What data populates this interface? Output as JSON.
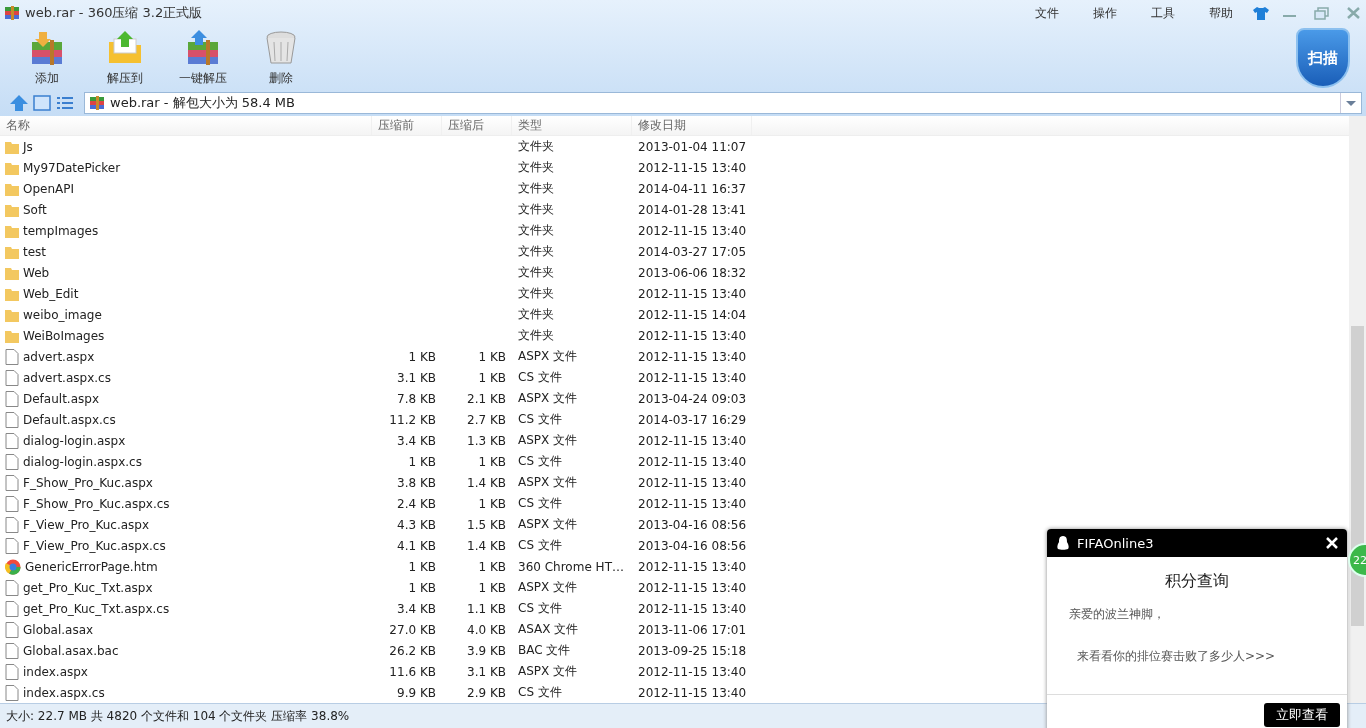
{
  "window": {
    "title": "web.rar - 360压缩 3.2正式版"
  },
  "menu": [
    "文件",
    "操作",
    "工具",
    "帮助"
  ],
  "toolbar": [
    {
      "label": "添加",
      "kind": "add"
    },
    {
      "label": "解压到",
      "kind": "extract"
    },
    {
      "label": "一键解压",
      "kind": "quick"
    },
    {
      "label": "删除",
      "kind": "delete"
    }
  ],
  "scan_button": {
    "label": "扫描"
  },
  "address": {
    "value": "web.rar - 解包大小为 58.4 MB"
  },
  "table": {
    "columns": [
      "名称",
      "压缩前",
      "压缩后",
      "类型",
      "修改日期"
    ],
    "rows": [
      {
        "kind": "folder",
        "name": "Js",
        "size": "",
        "packed": "",
        "type": "文件夹",
        "date": "2013-01-04 11:07"
      },
      {
        "kind": "folder",
        "name": "My97DatePicker",
        "size": "",
        "packed": "",
        "type": "文件夹",
        "date": "2012-11-15 13:40"
      },
      {
        "kind": "folder",
        "name": "OpenAPI",
        "size": "",
        "packed": "",
        "type": "文件夹",
        "date": "2014-04-11 16:37"
      },
      {
        "kind": "folder",
        "name": "Soft",
        "size": "",
        "packed": "",
        "type": "文件夹",
        "date": "2014-01-28 13:41"
      },
      {
        "kind": "folder",
        "name": "tempImages",
        "size": "",
        "packed": "",
        "type": "文件夹",
        "date": "2012-11-15 13:40"
      },
      {
        "kind": "folder",
        "name": "test",
        "size": "",
        "packed": "",
        "type": "文件夹",
        "date": "2014-03-27 17:05"
      },
      {
        "kind": "folder",
        "name": "Web",
        "size": "",
        "packed": "",
        "type": "文件夹",
        "date": "2013-06-06 18:32"
      },
      {
        "kind": "folder",
        "name": "Web_Edit",
        "size": "",
        "packed": "",
        "type": "文件夹",
        "date": "2012-11-15 13:40"
      },
      {
        "kind": "folder",
        "name": "weibo_image",
        "size": "",
        "packed": "",
        "type": "文件夹",
        "date": "2012-11-15 14:04"
      },
      {
        "kind": "folder",
        "name": "WeiBoImages",
        "size": "",
        "packed": "",
        "type": "文件夹",
        "date": "2012-11-15 13:40"
      },
      {
        "kind": "file",
        "name": "advert.aspx",
        "size": "1 KB",
        "packed": "1 KB",
        "type": "ASPX 文件",
        "date": "2012-11-15 13:40"
      },
      {
        "kind": "file",
        "name": "advert.aspx.cs",
        "size": "3.1 KB",
        "packed": "1 KB",
        "type": "CS 文件",
        "date": "2012-11-15 13:40"
      },
      {
        "kind": "file",
        "name": "Default.aspx",
        "size": "7.8 KB",
        "packed": "2.1 KB",
        "type": "ASPX 文件",
        "date": "2013-04-24 09:03"
      },
      {
        "kind": "file",
        "name": "Default.aspx.cs",
        "size": "11.2 KB",
        "packed": "2.7 KB",
        "type": "CS 文件",
        "date": "2014-03-17 16:29"
      },
      {
        "kind": "file",
        "name": "dialog-login.aspx",
        "size": "3.4 KB",
        "packed": "1.3 KB",
        "type": "ASPX 文件",
        "date": "2012-11-15 13:40"
      },
      {
        "kind": "file",
        "name": "dialog-login.aspx.cs",
        "size": "1 KB",
        "packed": "1 KB",
        "type": "CS 文件",
        "date": "2012-11-15 13:40"
      },
      {
        "kind": "file",
        "name": "F_Show_Pro_Kuc.aspx",
        "size": "3.8 KB",
        "packed": "1.4 KB",
        "type": "ASPX 文件",
        "date": "2012-11-15 13:40"
      },
      {
        "kind": "file",
        "name": "F_Show_Pro_Kuc.aspx.cs",
        "size": "2.4 KB",
        "packed": "1 KB",
        "type": "CS 文件",
        "date": "2012-11-15 13:40"
      },
      {
        "kind": "file",
        "name": "F_View_Pro_Kuc.aspx",
        "size": "4.3 KB",
        "packed": "1.5 KB",
        "type": "ASPX 文件",
        "date": "2013-04-16 08:56"
      },
      {
        "kind": "file",
        "name": "F_View_Pro_Kuc.aspx.cs",
        "size": "4.1 KB",
        "packed": "1.4 KB",
        "type": "CS 文件",
        "date": "2013-04-16 08:56"
      },
      {
        "kind": "web",
        "name": "GenericErrorPage.htm",
        "size": "1 KB",
        "packed": "1 KB",
        "type": "360 Chrome HT…",
        "date": "2012-11-15 13:40"
      },
      {
        "kind": "file",
        "name": "get_Pro_Kuc_Txt.aspx",
        "size": "1 KB",
        "packed": "1 KB",
        "type": "ASPX 文件",
        "date": "2012-11-15 13:40"
      },
      {
        "kind": "file",
        "name": "get_Pro_Kuc_Txt.aspx.cs",
        "size": "3.4 KB",
        "packed": "1.1 KB",
        "type": "CS 文件",
        "date": "2012-11-15 13:40"
      },
      {
        "kind": "file",
        "name": "Global.asax",
        "size": "27.0 KB",
        "packed": "4.0 KB",
        "type": "ASAX 文件",
        "date": "2013-11-06 17:01"
      },
      {
        "kind": "file",
        "name": "Global.asax.bac",
        "size": "26.2 KB",
        "packed": "3.9 KB",
        "type": "BAC 文件",
        "date": "2013-09-25 15:18"
      },
      {
        "kind": "file",
        "name": "index.aspx",
        "size": "11.6 KB",
        "packed": "3.1 KB",
        "type": "ASPX 文件",
        "date": "2012-11-15 13:40"
      },
      {
        "kind": "file",
        "name": "index.aspx.cs",
        "size": "9.9 KB",
        "packed": "2.9 KB",
        "type": "CS 文件",
        "date": "2012-11-15 13:40"
      }
    ]
  },
  "status_bar": "大小: 22.7 MB 共 4820 个文件和 104 个文件夹 压缩率 38.8%",
  "popup": {
    "title": "FIFAOnline3",
    "heading": "积分查询",
    "greeting": "亲爱的波兰神脚，",
    "message": "来看看你的排位赛击败了多少人>>>",
    "button": "立即查看"
  },
  "floating_ball": {
    "label": "22"
  }
}
